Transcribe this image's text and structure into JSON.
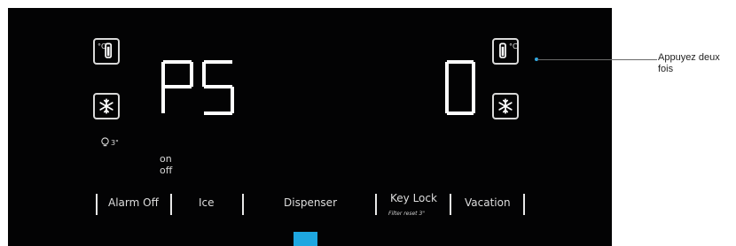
{
  "display": {
    "left_code": "PS",
    "right_code": "0",
    "temp_unit": "°C",
    "timer_label": "3\"",
    "on_label": "on",
    "off_label": "off"
  },
  "buttons": {
    "alarm_off": "Alarm Off",
    "ice": "Ice",
    "dispenser": "Dispenser",
    "key_lock": "Key Lock",
    "key_lock_sub": "Filter reset 3\"",
    "vacation": "Vacation"
  },
  "callout": {
    "text": "Appuyez deux fois"
  },
  "colors": {
    "panel": "#030304",
    "indicator": "#1ea7e1",
    "display": "#ffffff"
  },
  "icons": {
    "freezer_temp": "thermometer-icon",
    "freezer_power": "snowflake-icon",
    "fridge_temp": "thermometer-icon",
    "fridge_power": "snowflake-icon",
    "ice_timer": "light-bulb-icon"
  }
}
